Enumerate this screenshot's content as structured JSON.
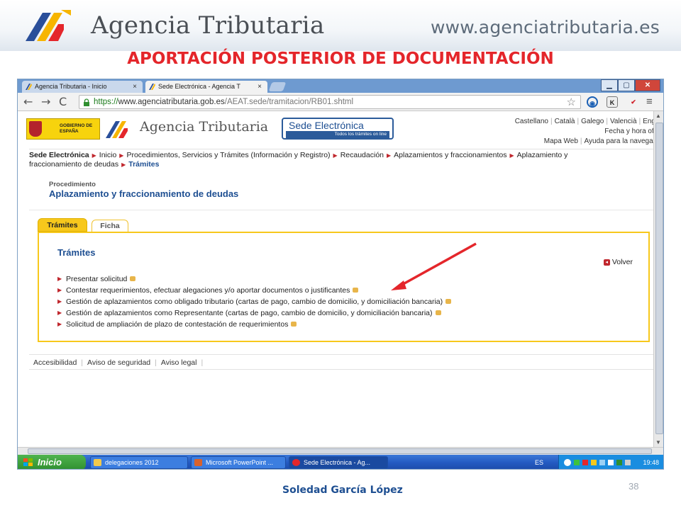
{
  "slide": {
    "brand": "Agencia Tributaria",
    "url": "www.agenciatributaria.es",
    "title": "APORTACIÓN POSTERIOR DE DOCUMENTACIÓN",
    "author": "Soledad García López",
    "number": "38",
    "colors": {
      "title": "#e4262b",
      "accent_blue": "#1e4f92",
      "tab_yellow": "#f7c81c"
    }
  },
  "browser": {
    "tabs": [
      {
        "label": "Agencia Tributaria - Inicio",
        "close": "×"
      },
      {
        "label": "Sede Electrónica - Agencia T",
        "close": "×"
      }
    ],
    "window_buttons": {
      "minimize": "▁",
      "maximize": "▢",
      "close": "✕"
    },
    "toolbar": {
      "back": "←",
      "forward": "→",
      "reload": "C",
      "url_scheme": "https://",
      "url_host": "www.agenciatributaria.gob.es",
      "url_path": "/AEAT.sede/tramitacion/RB01.shtml",
      "star": "☆",
      "ext2": "K",
      "menu": "≡"
    }
  },
  "page": {
    "gov_logo_text": "GOBIERNO DE ESPAÑA",
    "brand": "Agencia Tributaria",
    "sede_title": "Sede Electrónica",
    "sede_sub": "Todos los trámites on line",
    "lang_links": [
      "Castellano",
      "Català",
      "Galego",
      "Valencià",
      "English"
    ],
    "util_links_1": "Fecha y hora oficial",
    "util_links_2": [
      "Mapa Web",
      "Ayuda para la navegación"
    ],
    "breadcrumb": {
      "root": "Sede Electrónica",
      "items": [
        "Inicio",
        "Procedimientos, Servicios y Trámites (Información y Registro)",
        "Recaudación",
        "Aplazamientos y fraccionamientos",
        "Aplazamiento y"
      ],
      "continuation": "fraccionamiento de deudas",
      "current": "Trámites"
    },
    "procedure_label": "Procedimiento",
    "procedure_title": "Aplazamiento y fraccionamiento de deudas",
    "tabs": {
      "tramites": "Trámites",
      "ficha": "Ficha"
    },
    "panel_title": "Trámites",
    "volver": "Volver",
    "procedures": [
      "Presentar solicitud",
      "Contestar requerimientos, efectuar alegaciones y/o aportar documentos o justificantes",
      "Gestión de aplazamientos como obligado tributario (cartas de pago, cambio de domicilio, y domiciliación bancaria)",
      "Gestión de aplazamientos como Representante (cartas de pago, cambio de domicilio, y domiciliación bancaria)",
      "Solicitud de ampliación de plazo de contestación de requerimientos"
    ],
    "footer_links": [
      "Accesibilidad",
      "Aviso de seguridad",
      "Aviso legal"
    ]
  },
  "taskbar": {
    "start": "Inicio",
    "items": [
      "delegaciones 2012",
      "Microsoft PowerPoint ...",
      "Sede Electrónica - Ag..."
    ],
    "lang": "ES",
    "time": "19:48"
  }
}
